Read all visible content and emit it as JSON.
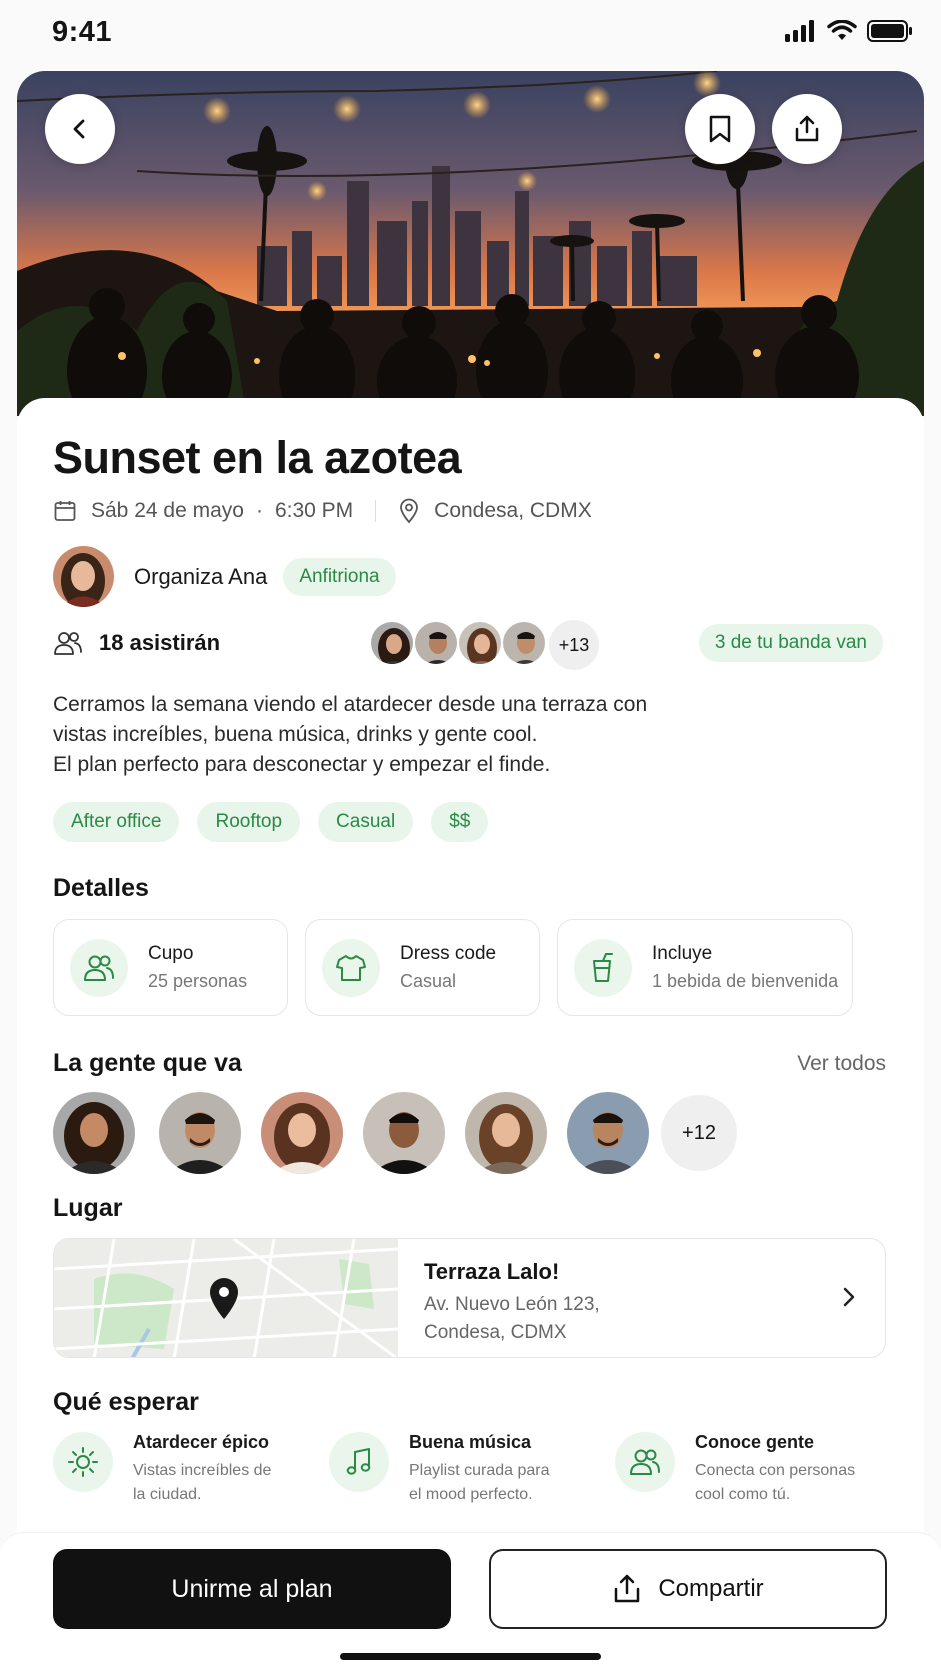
{
  "status_bar": {
    "time": "9:41"
  },
  "event": {
    "title": "Sunset en la azotea",
    "date": "Sáb 24 de mayo",
    "time": "6:30 PM",
    "location": "Condesa, CDMX"
  },
  "organizer": {
    "text": "Organiza Ana",
    "badge": "Anfitriona"
  },
  "attendance": {
    "count": "18 asistirán",
    "more": "+13",
    "friends": "3 de tu banda van"
  },
  "description": [
    "Cerramos la semana viendo el atardecer desde una terraza con",
    "vistas increíbles, buena música, drinks y gente cool.",
    "El plan perfecto para desconectar y empezar el finde."
  ],
  "tags": [
    "After office",
    "Rooftop",
    "Casual",
    "$$"
  ],
  "details": {
    "title": "Detalles",
    "items": [
      {
        "label": "Cupo",
        "value": "25 personas",
        "icon": "people-icon"
      },
      {
        "label": "Dress code",
        "value": "Casual",
        "icon": "shirt-icon"
      },
      {
        "label": "Incluye",
        "value": "1 bebida de bienvenida",
        "icon": "drink-icon"
      }
    ]
  },
  "people": {
    "title": "La gente que va",
    "see_all": "Ver todos",
    "more": "+12"
  },
  "place": {
    "title": "Lugar",
    "name": "Terraza Lalo!",
    "address_line1": "Av. Nuevo León 123,",
    "address_line2": "Condesa, CDMX"
  },
  "expect": {
    "title": "Qué esperar",
    "items": [
      {
        "title": "Atardecer épico",
        "line1": "Vistas increíbles de",
        "line2": "la ciudad.",
        "icon": "sun-icon"
      },
      {
        "title": "Buena música",
        "line1": "Playlist curada para",
        "line2": "el mood perfecto.",
        "icon": "music-icon"
      },
      {
        "title": "Conoce gente",
        "line1": "Conecta con personas",
        "line2": "cool como tú.",
        "icon": "people-icon"
      }
    ]
  },
  "actions": {
    "join": "Unirme al plan",
    "share": "Compartir"
  },
  "colors": {
    "accent_green": "#2a8a45",
    "pill_bg": "#e8f5ea",
    "primary_button": "#111111"
  }
}
